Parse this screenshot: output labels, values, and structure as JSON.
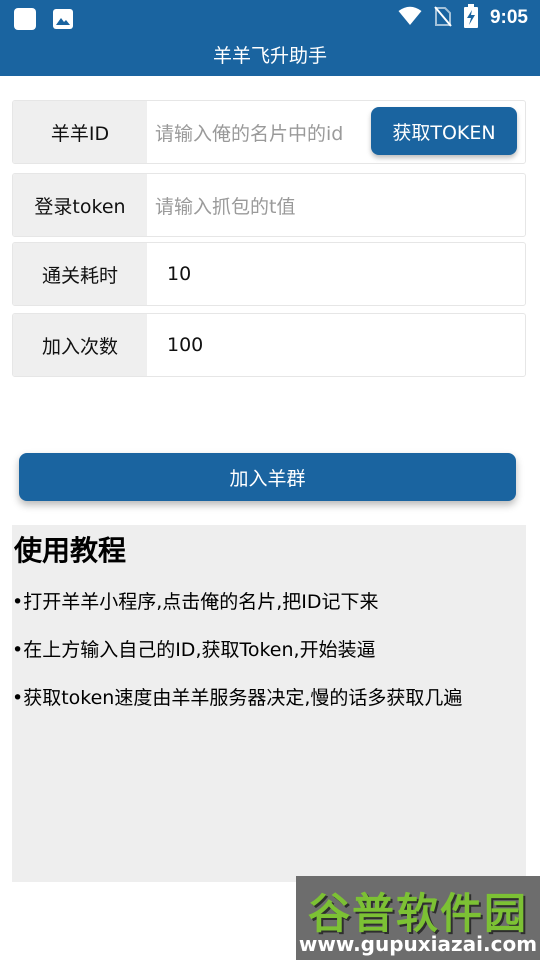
{
  "status_bar": {
    "time": "9:05",
    "icons": [
      "app-square-icon",
      "image-icon",
      "wifi-icon",
      "no-sim-icon",
      "battery-charging-icon"
    ]
  },
  "app_bar": {
    "title": "羊羊飞升助手"
  },
  "form": {
    "sheep_id": {
      "label": "羊羊ID",
      "placeholder": "请输入俺的名片中的id",
      "button": "获取TOKEN"
    },
    "login_token": {
      "label": "登录token",
      "placeholder": "请输入抓包的t值"
    },
    "clear_time": {
      "label": "通关耗时",
      "value": "10"
    },
    "join_count": {
      "label": "加入次数",
      "value": "100"
    }
  },
  "join_button": "加入羊群",
  "tutorial": {
    "title": "使用教程",
    "items": [
      "•打开羊羊小程序,点击俺的名片,把ID记下来",
      "•在上方输入自己的ID,获取Token,开始装逼",
      "•获取token速度由羊羊服务器决定,慢的话多获取几遍"
    ]
  },
  "watermark": {
    "name": "谷普软件园",
    "url": "www.gupuxiazai.com"
  },
  "colors": {
    "primary": "#1a64a0",
    "label_bg": "#efefef",
    "panel_bg": "#eeeeee",
    "placeholder": "#9a9a9a"
  }
}
